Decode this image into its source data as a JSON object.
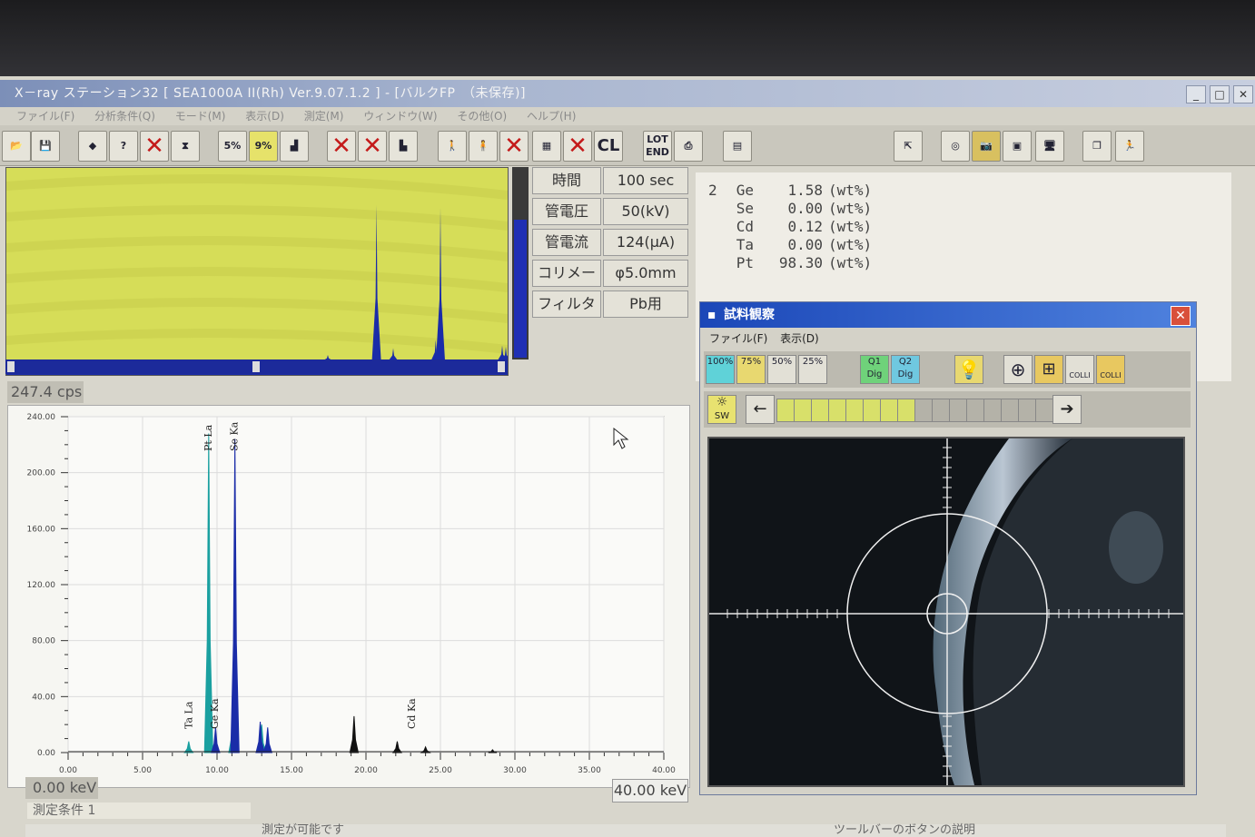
{
  "window": {
    "title": "X－ray ステーション32 [ SEA1000A II(Rh) Ver.9.07.1.2 ] - [バルクFP　（未保存)]",
    "minimize": "_",
    "maximize": "□",
    "close": "✕"
  },
  "menu": [
    "ファイル(F)",
    "分析条件(Q)",
    "モード(M)",
    "表示(D)",
    "測定(M)",
    "ウィンドウ(W)",
    "その他(O)",
    "ヘルプ(H)"
  ],
  "toolbar": {
    "percent5": "5%",
    "percent9": "9%",
    "cl": "CL",
    "lot": "LOT",
    "end": "END"
  },
  "spectrum_top": {
    "cps": "247.4 cps",
    "bg_color": "#d6dd58",
    "peak_color": "#1a2ca8"
  },
  "params": [
    {
      "label": "時間",
      "value": "100 sec"
    },
    {
      "label": "管電圧",
      "value": "50(kV)"
    },
    {
      "label": "管電流",
      "value": "124(μA)"
    },
    {
      "label": "コリメータ",
      "value": "φ5.0mm"
    },
    {
      "label": "フィルタ",
      "value": "Pb用"
    }
  ],
  "results": [
    {
      "n": "2",
      "element": "Ge",
      "value": "1.58",
      "unit": "(wt%)"
    },
    {
      "n": "",
      "element": "Se",
      "value": "0.00",
      "unit": "(wt%)"
    },
    {
      "n": "",
      "element": "Cd",
      "value": "0.12",
      "unit": "(wt%)"
    },
    {
      "n": "",
      "element": "Ta",
      "value": "0.00",
      "unit": "(wt%)"
    },
    {
      "n": "",
      "element": "Pt",
      "value": "98.30",
      "unit": "(wt%)"
    }
  ],
  "chart_data": {
    "type": "line",
    "xlim": [
      0,
      40
    ],
    "ylim": [
      0,
      240
    ],
    "x_ticks": [
      "0.00",
      "5.00",
      "10.00",
      "15.00",
      "20.00",
      "25.00",
      "30.00",
      "35.00",
      "40.00"
    ],
    "y_ticks": [
      "0.00",
      "40.00",
      "80.00",
      "120.00",
      "160.00",
      "200.00",
      "240.00"
    ],
    "grid": true,
    "series": [
      {
        "color": "#1aa0a0",
        "peaks": [
          [
            8.1,
            8
          ],
          [
            9.44,
            228
          ],
          [
            11.07,
            30
          ],
          [
            13.0,
            20
          ]
        ]
      },
      {
        "color": "#1a2ca8",
        "peaks": [
          [
            9.9,
            18
          ],
          [
            11.2,
            224
          ],
          [
            12.9,
            22
          ],
          [
            13.4,
            18
          ]
        ]
      },
      {
        "color": "#101010",
        "peaks": [
          [
            19.2,
            26
          ],
          [
            22.1,
            8
          ],
          [
            24.0,
            4
          ],
          [
            28.5,
            2
          ]
        ]
      }
    ],
    "annotations": [
      {
        "text": "Pt La",
        "x": 9.44
      },
      {
        "text": "Se Ka",
        "x": 11.2
      },
      {
        "text": "Ta La",
        "x": 8.14
      },
      {
        "text": "Ge Ka",
        "x": 9.88
      },
      {
        "text": "Cd Ka",
        "x": 23.1
      }
    ]
  },
  "energy": {
    "min_label": "0.00 keV",
    "max_label": "40.00 keV"
  },
  "condition_tab": "測定条件 1",
  "status": {
    "left": "測定が可能です",
    "right": "ツールバーのボタンの説明"
  },
  "observation": {
    "title": "試料観察",
    "close": "✕",
    "menu": [
      "ファイル(F)",
      "表示(D)"
    ],
    "zoom": [
      "100%",
      "75%",
      "50%",
      "25%"
    ],
    "dig1": "Q1",
    "dig2": "Q2",
    "dig_sub": "Dig",
    "colli": "COLLI",
    "sw": "SW",
    "left_arrow": "←",
    "right_arrow": "➔",
    "lamp_level": 0.5,
    "lamp_segments": 16
  }
}
